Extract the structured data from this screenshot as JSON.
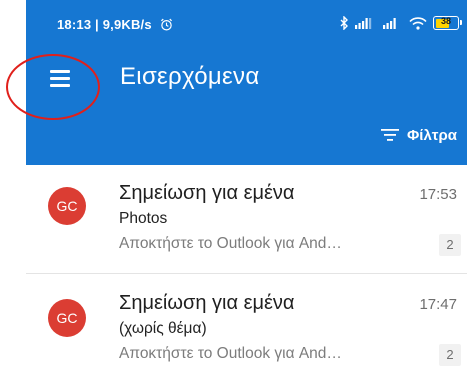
{
  "status_bar": {
    "left_text": "18:13 | 9,9KB/s",
    "alarm_icon": "alarm-clock-icon",
    "bluetooth_icon": "bluetooth-icon",
    "signal_icon": "signal-bars-icon",
    "wifi_icon": "wifi-icon",
    "battery_level": "38"
  },
  "header": {
    "menu_icon": "hamburger-menu-icon",
    "title": "Εισερχόμενα",
    "filter_label": "Φίλτρα",
    "filter_icon": "filter-icon",
    "background_color": "#1677d2"
  },
  "annotation": {
    "color": "#e0201b"
  },
  "messages": [
    {
      "avatar_initials": "GC",
      "avatar_color": "#db3d33",
      "sender": "Σημείωση για εμένα",
      "time": "17:53",
      "subject": "Photos",
      "preview": "Αποκτήστε το Outlook για And…",
      "count": "2"
    },
    {
      "avatar_initials": "GC",
      "avatar_color": "#db3d33",
      "sender": "Σημείωση για εμένα",
      "time": "17:47",
      "subject": "(χωρίς θέμα)",
      "preview": "Αποκτήστε το Outlook για And…",
      "count": "2"
    }
  ]
}
